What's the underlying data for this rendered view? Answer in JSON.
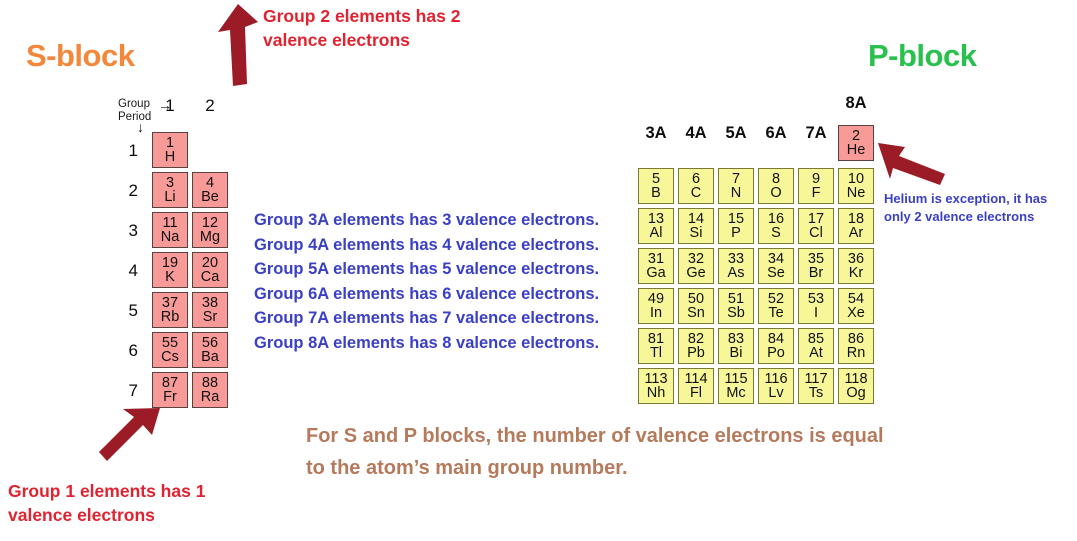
{
  "titles": {
    "s_block": "S-block",
    "p_block": "P-block",
    "s_block_color": "#F3873B",
    "p_block_color": "#29C04D"
  },
  "axes": {
    "group_label": "Group",
    "period_label": "Period",
    "group_arrow_glyph": "→",
    "period_arrow_glyph": "↓"
  },
  "s_block": {
    "group_headers": [
      "1",
      "2"
    ],
    "period_numbers": [
      "1",
      "2",
      "3",
      "4",
      "5",
      "6",
      "7"
    ],
    "cell_color": "#F79A98",
    "rows": [
      [
        {
          "number": "1",
          "symbol": "H"
        },
        null
      ],
      [
        {
          "number": "3",
          "symbol": "Li"
        },
        {
          "number": "4",
          "symbol": "Be"
        }
      ],
      [
        {
          "number": "11",
          "symbol": "Na"
        },
        {
          "number": "12",
          "symbol": "Mg"
        }
      ],
      [
        {
          "number": "19",
          "symbol": "K"
        },
        {
          "number": "20",
          "symbol": "Ca"
        }
      ],
      [
        {
          "number": "37",
          "symbol": "Rb"
        },
        {
          "number": "38",
          "symbol": "Sr"
        }
      ],
      [
        {
          "number": "55",
          "symbol": "Cs"
        },
        {
          "number": "56",
          "symbol": "Ba"
        }
      ],
      [
        {
          "number": "87",
          "symbol": "Fr"
        },
        {
          "number": "88",
          "symbol": "Ra"
        }
      ]
    ]
  },
  "p_block": {
    "group_headers": [
      "3A",
      "4A",
      "5A",
      "6A",
      "7A",
      "8A"
    ],
    "cell_color": "#F7F79A",
    "helium_cell_color": "#F79A98",
    "helium": {
      "number": "2",
      "symbol": "He"
    },
    "rows": [
      [
        {
          "number": "5",
          "symbol": "B"
        },
        {
          "number": "6",
          "symbol": "C"
        },
        {
          "number": "7",
          "symbol": "N"
        },
        {
          "number": "8",
          "symbol": "O"
        },
        {
          "number": "9",
          "symbol": "F"
        },
        {
          "number": "10",
          "symbol": "Ne"
        }
      ],
      [
        {
          "number": "13",
          "symbol": "Al"
        },
        {
          "number": "14",
          "symbol": "Si"
        },
        {
          "number": "15",
          "symbol": "P"
        },
        {
          "number": "16",
          "symbol": "S"
        },
        {
          "number": "17",
          "symbol": "Cl"
        },
        {
          "number": "18",
          "symbol": "Ar"
        }
      ],
      [
        {
          "number": "31",
          "symbol": "Ga"
        },
        {
          "number": "32",
          "symbol": "Ge"
        },
        {
          "number": "33",
          "symbol": "As"
        },
        {
          "number": "34",
          "symbol": "Se"
        },
        {
          "number": "35",
          "symbol": "Br"
        },
        {
          "number": "36",
          "symbol": "Kr"
        }
      ],
      [
        {
          "number": "49",
          "symbol": "In"
        },
        {
          "number": "50",
          "symbol": "Sn"
        },
        {
          "number": "51",
          "symbol": "Sb"
        },
        {
          "number": "52",
          "symbol": "Te"
        },
        {
          "number": "53",
          "symbol": "I"
        },
        {
          "number": "54",
          "symbol": "Xe"
        }
      ],
      [
        {
          "number": "81",
          "symbol": "Tl"
        },
        {
          "number": "82",
          "symbol": "Pb"
        },
        {
          "number": "83",
          "symbol": "Bi"
        },
        {
          "number": "84",
          "symbol": "Po"
        },
        {
          "number": "85",
          "symbol": "At"
        },
        {
          "number": "86",
          "symbol": "Rn"
        }
      ],
      [
        {
          "number": "113",
          "symbol": "Nh"
        },
        {
          "number": "114",
          "symbol": "Fl"
        },
        {
          "number": "115",
          "symbol": "Mc"
        },
        {
          "number": "116",
          "symbol": "Lv"
        },
        {
          "number": "117",
          "symbol": "Ts"
        },
        {
          "number": "118",
          "symbol": "Og"
        }
      ]
    ]
  },
  "annotations": {
    "group2": "Group 2 elements has 2\nvalence electrons",
    "group1": "Group 1 elements has 1\nvalence electrons",
    "helium_note": "Helium is exception, it has\nonly 2 valence electrons",
    "middle_lines": "Group 3A elements has 3 valence electrons.\nGroup 4A elements has 4 valence electrons.\nGroup 5A elements has 5 valence electrons.\nGroup 6A elements has 6 valence electrons.\nGroup 7A elements has 7 valence electrons.\nGroup 8A elements has 8 valence electrons.",
    "summary": "For S and P blocks, the number of valence electrons is equal\nto the atom’s main group number.",
    "red_color": "#E02330",
    "blue_color": "#3A3FC4",
    "brown_color": "#B57A5C",
    "arrow_color": "#9B1B26"
  }
}
